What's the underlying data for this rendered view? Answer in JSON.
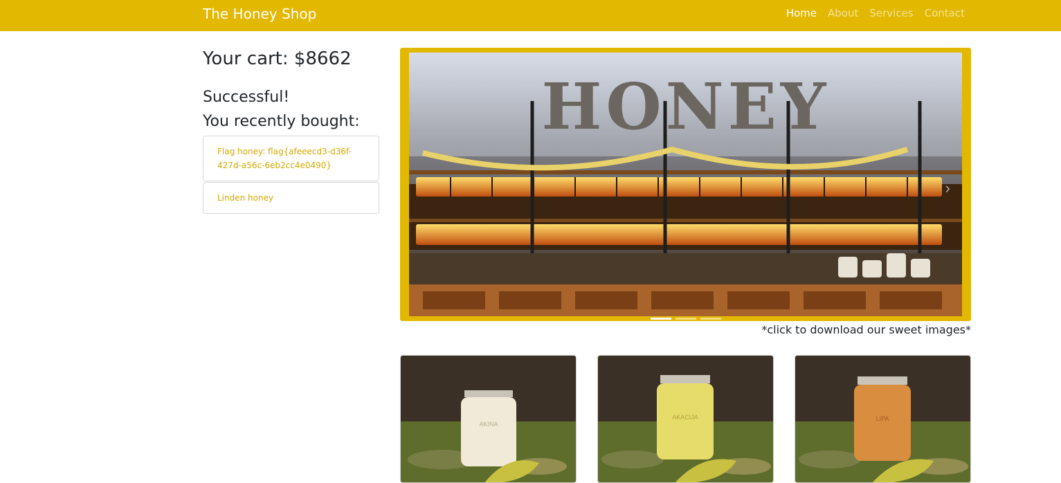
{
  "navbar": {
    "brand": "The Honey Shop",
    "links": [
      {
        "label": "Home",
        "active": true
      },
      {
        "label": "About",
        "active": false
      },
      {
        "label": "Services",
        "active": false
      },
      {
        "label": "Contact",
        "active": false
      }
    ],
    "bg_color": "#e3b800"
  },
  "sidebar": {
    "cart_text": "Your cart: $8662",
    "status_text": "Successful!",
    "recent_heading": "You recently bought:",
    "items": [
      {
        "label": "Flag honey: flag{afeeecd3-d36f-427d-a56c-6eb2cc4e0490}"
      },
      {
        "label": "Linden honey"
      }
    ]
  },
  "carousel": {
    "sign_text": "HONEY",
    "caption": "*click to download our sweet images*",
    "next_icon": "chevron-right-icon",
    "active_index": 0,
    "indicators": [
      true,
      false,
      false
    ]
  },
  "products": [
    {
      "jar_label": "AKINA",
      "jar_color": "#f1ead8"
    },
    {
      "jar_label": "AKACIJA",
      "jar_color": "#e6dc6a"
    },
    {
      "jar_label": "LIPA",
      "jar_color": "#d98d3e"
    }
  ]
}
